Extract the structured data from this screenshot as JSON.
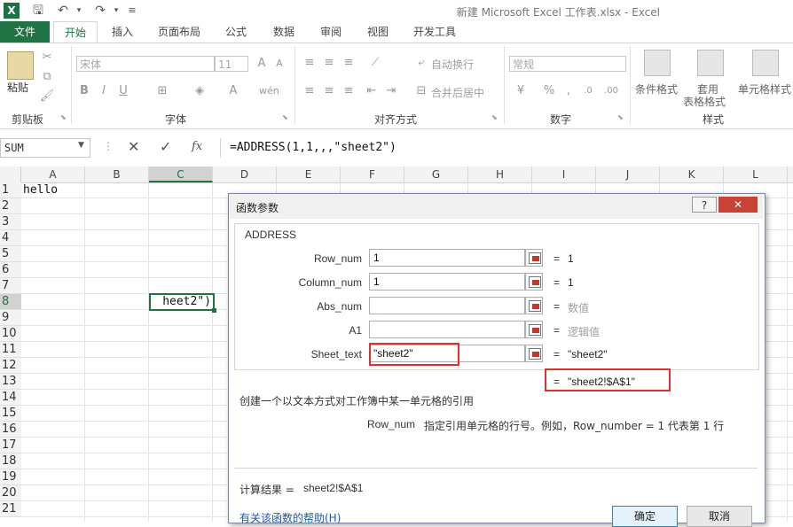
{
  "window": {
    "title": "新建 Microsoft Excel 工作表.xlsx - Excel"
  },
  "tabs": [
    "文件",
    "开始",
    "插入",
    "页面布局",
    "公式",
    "数据",
    "审阅",
    "视图",
    "开发工具"
  ],
  "ribbon": {
    "clipboard": {
      "paste": "粘贴",
      "label": "剪贴板"
    },
    "font": {
      "name": "宋体",
      "size": "11",
      "label": "字体"
    },
    "align": {
      "wrap": "自动换行",
      "merge": "合并后居中",
      "label": "对齐方式"
    },
    "number": {
      "format": "常规",
      "label": "数字"
    },
    "styles": {
      "cond": "条件格式",
      "table1": "套用",
      "table2": "表格格式",
      "cell": "单元格样式",
      "label": "样式"
    }
  },
  "formula_bar": {
    "name_box": "SUM",
    "fx": "fx",
    "formula": "=ADDRESS(1,1,,,\"sheet2\")"
  },
  "grid": {
    "columns": [
      "A",
      "B",
      "C",
      "D",
      "E",
      "F",
      "G",
      "H",
      "I",
      "J",
      "K",
      "L"
    ],
    "rows": [
      "1",
      "2",
      "3",
      "4",
      "5",
      "6",
      "7",
      "8",
      "9",
      "10",
      "11",
      "12",
      "13",
      "14",
      "15",
      "16",
      "17",
      "18",
      "19",
      "20",
      "21"
    ],
    "a1": "hello",
    "c8": "heet2\")"
  },
  "dialog": {
    "title": "函数参数",
    "help_glyph": "?",
    "close_glyph": "✕",
    "func_name": "ADDRESS",
    "args": [
      {
        "label": "Row_num",
        "value": "1",
        "result": "1"
      },
      {
        "label": "Column_num",
        "value": "1",
        "result": "1"
      },
      {
        "label": "Abs_num",
        "value": "",
        "result": "数值"
      },
      {
        "label": "A1",
        "value": "",
        "result": "逻辑值"
      },
      {
        "label": "Sheet_text",
        "value": "\"sheet2\"",
        "result": "\"sheet2\""
      }
    ],
    "eq": "=",
    "func_result": "\"sheet2!$A$1\"",
    "description": "创建一个以文本方式对工作簿中某一单元格的引用",
    "arg_help_name": "Row_num",
    "arg_help_text": "指定引用单元格的行号。例如，Row_number = 1 代表第 1 行",
    "calc_result_label": "计算结果 =",
    "calc_result_value": "sheet2!$A$1",
    "help_link": "有关该函数的帮助(H)",
    "ok": "确定",
    "cancel": "取消"
  },
  "colors": {
    "excel_green": "#217346",
    "red_highlight": "#e03030"
  }
}
